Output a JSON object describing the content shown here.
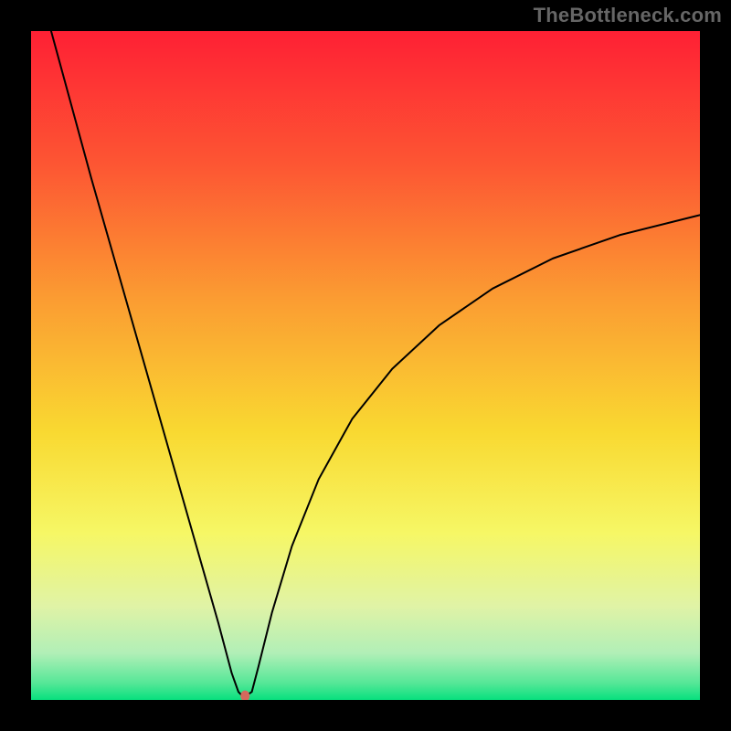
{
  "watermark": "TheBottleneck.com",
  "chart_data": {
    "type": "line",
    "title": "",
    "xlabel": "",
    "ylabel": "",
    "xlim": [
      0,
      100
    ],
    "ylim": [
      0,
      100
    ],
    "grid": false,
    "legend": false,
    "background_gradient": {
      "direction": "vertical",
      "stops": [
        {
          "offset": 0.0,
          "color": "#fe2034"
        },
        {
          "offset": 0.2,
          "color": "#fd5633"
        },
        {
          "offset": 0.4,
          "color": "#fb9c32"
        },
        {
          "offset": 0.6,
          "color": "#f9d931"
        },
        {
          "offset": 0.75,
          "color": "#f6f765"
        },
        {
          "offset": 0.86,
          "color": "#e0f3a6"
        },
        {
          "offset": 0.93,
          "color": "#b1efb7"
        },
        {
          "offset": 0.975,
          "color": "#55e797"
        },
        {
          "offset": 1.0,
          "color": "#07e07e"
        }
      ]
    },
    "series": [
      {
        "name": "bottleneck-curve",
        "color": "#000000",
        "width": 2,
        "x": [
          3.0,
          6.0,
          9.0,
          12.0,
          15.0,
          18.0,
          21.0,
          24.0,
          26.0,
          28.0,
          30.0,
          31.0,
          31.8,
          33.0,
          34.0,
          36.0,
          39.0,
          43.0,
          48.0,
          54.0,
          61.0,
          69.0,
          78.0,
          88.0,
          100.0
        ],
        "y": [
          100.0,
          89.0,
          78.0,
          67.5,
          57.0,
          46.5,
          36.0,
          25.5,
          18.5,
          11.5,
          4.0,
          1.2,
          0.4,
          1.2,
          5.0,
          13.0,
          23.0,
          33.0,
          42.0,
          49.5,
          56.0,
          61.5,
          66.0,
          69.5,
          72.5
        ]
      }
    ],
    "marker": {
      "name": "min-bottleneck-marker",
      "x": 32.0,
      "y": 0.6,
      "color": "#d46a5d",
      "rx": 5,
      "ry": 6
    }
  }
}
